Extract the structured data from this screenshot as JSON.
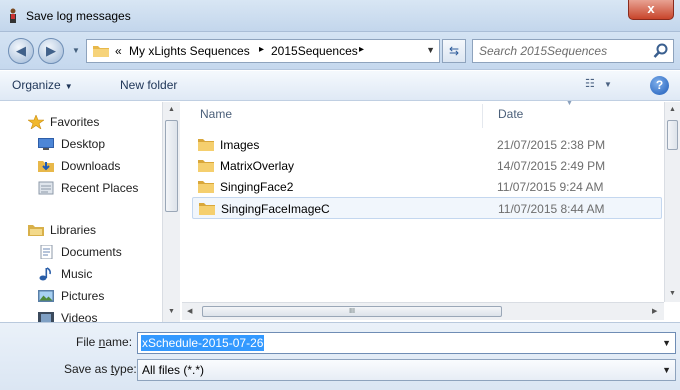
{
  "window": {
    "title": "Save log messages",
    "close_label": "x"
  },
  "address": {
    "crumbs": [
      "«",
      "My xLights Sequences",
      "▸",
      "2015Sequences",
      "▸"
    ],
    "search_placeholder": "Search 2015Sequences"
  },
  "toolbar": {
    "organize_label": "Organize",
    "new_folder_label": "New folder",
    "help_label": "?"
  },
  "nav": {
    "favorites_label": "Favorites",
    "favorites": [
      "Desktop",
      "Downloads",
      "Recent Places"
    ],
    "libraries_label": "Libraries",
    "libraries": [
      "Documents",
      "Music",
      "Pictures",
      "Videos"
    ]
  },
  "filelist": {
    "columns": [
      "Name",
      "Date"
    ],
    "rows": [
      {
        "name": "Images",
        "date": "21/07/2015 2:38 PM"
      },
      {
        "name": "MatrixOverlay",
        "date": "14/07/2015 2:49 PM"
      },
      {
        "name": "SingingFace2",
        "date": "11/07/2015 9:24 AM"
      },
      {
        "name": "SingingFaceImageC",
        "date": "11/07/2015 8:44 AM",
        "selected": true
      }
    ],
    "hscroll_grip": "III"
  },
  "save": {
    "filename_label_pre": "File ",
    "filename_label_u": "n",
    "filename_label_post": "ame:",
    "filename_value": "xSchedule-2015-07-26",
    "type_label_pre": "Save as ",
    "type_label_u": "t",
    "type_label_post": "ype:",
    "type_value": "All files (*.*)"
  },
  "colors": {
    "selection": "#3399ff",
    "titlebar": "#c3d6ec",
    "close": "#c8452b"
  }
}
